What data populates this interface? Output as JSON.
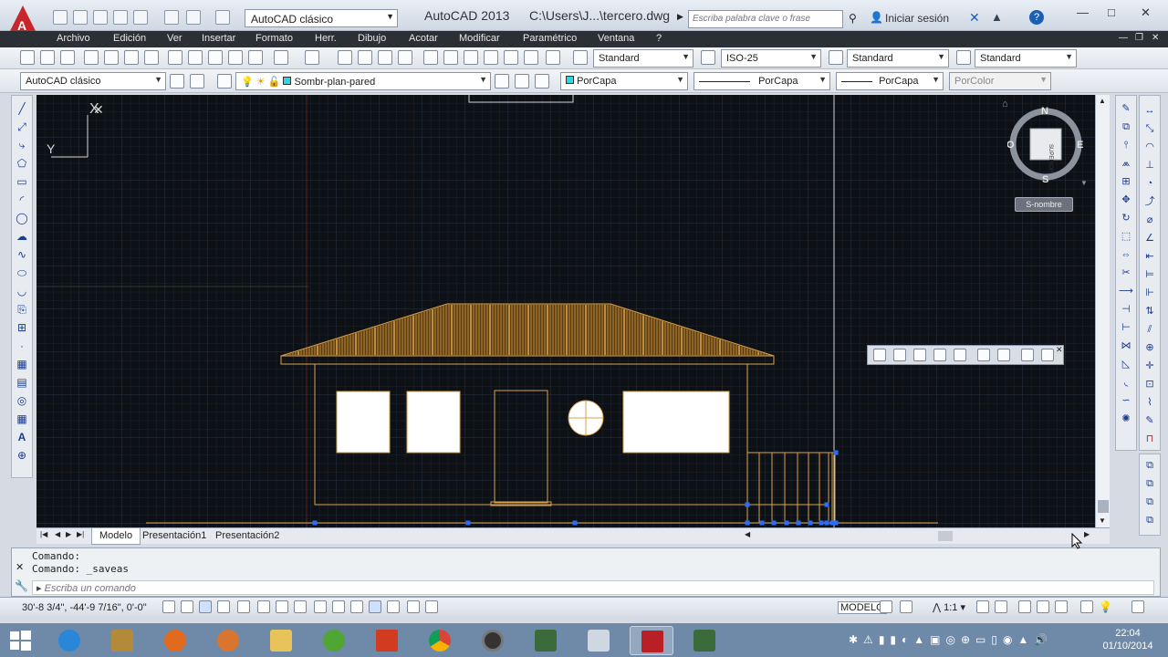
{
  "titlebar": {
    "app_letter": "A",
    "workspace": "AutoCAD clásico",
    "app_title": "AutoCAD 2013",
    "file_title": "C:\\Users\\J...\\tercero.dwg",
    "search_placeholder": "Escriba palabra clave o frase",
    "signin": "Iniciar sesión"
  },
  "menu": [
    "Archivo",
    "Edición",
    "Ver",
    "Insertar",
    "Formato",
    "Herr.",
    "Dibujo",
    "Acotar",
    "Modificar",
    "Paramétrico",
    "Ventana",
    "?"
  ],
  "toolbar1": {
    "text_style": "Standard",
    "dim_style": "ISO-25",
    "table_style": "Standard",
    "mleader_style": "Standard"
  },
  "toolbar2": {
    "workspace": "AutoCAD clásico",
    "layer": "Sombr-plan-pared",
    "color": "PorCapa",
    "linetype": "PorCapa",
    "lineweight": "PorCapa",
    "plotstyle": "PorColor"
  },
  "canvas": {
    "y_label": "Y",
    "x_label": "X",
    "compass": {
      "n": "N",
      "s": "S",
      "e": "E",
      "w": "O",
      "face": "SUPERIOR"
    },
    "wcs": "S-nombre"
  },
  "tabs": [
    "Modelo",
    "Presentación1",
    "Presentación2"
  ],
  "command": {
    "line1": "Comando:",
    "line2": "Comando:  _saveas",
    "input_placeholder": "Escriba un comando"
  },
  "status": {
    "coords": "30'-8 3/4\",  -44'-9 7/16\", 0'-0\"",
    "mode": "MODELO",
    "scale": "1:1"
  },
  "clock": {
    "time": "22:04",
    "date": "01/10/2014"
  },
  "colors": {
    "drawing": "#d9a24a",
    "background": "#0d1116",
    "grip": "#2b6cff"
  }
}
